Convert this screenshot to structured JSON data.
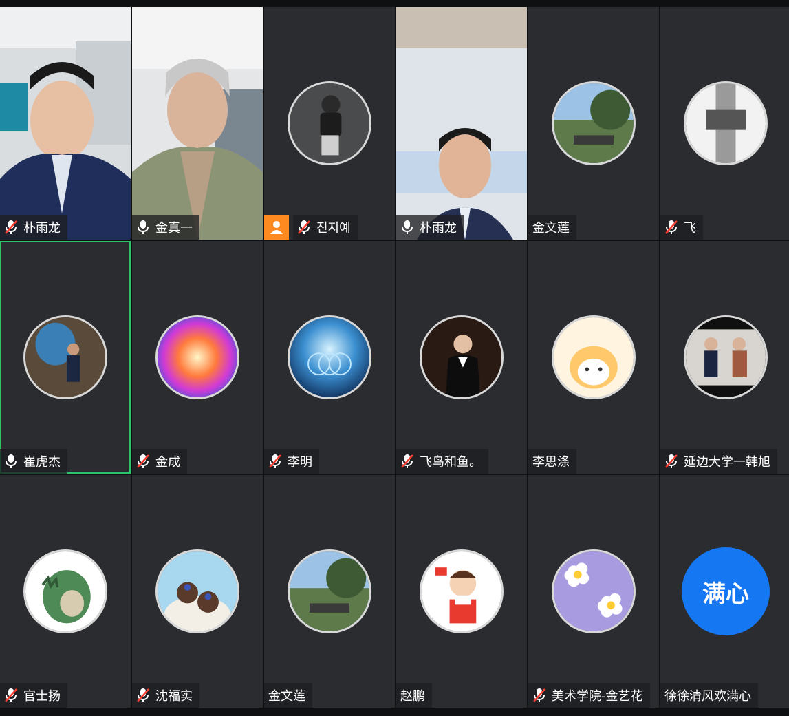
{
  "meeting": {
    "participants": [
      {
        "name": "朴雨龙",
        "mic": "muted",
        "type": "video",
        "active": false
      },
      {
        "name": "金真一",
        "mic": "on",
        "type": "video",
        "active": false
      },
      {
        "name": "진지예",
        "mic": "muted",
        "type": "avatar",
        "host_badge": true,
        "active": false
      },
      {
        "name": "朴雨龙",
        "mic": "on",
        "type": "video",
        "active": true
      },
      {
        "name": "金文莲",
        "mic": "none",
        "type": "avatar",
        "active": false
      },
      {
        "name": "飞",
        "mic": "muted",
        "type": "avatar",
        "active": false
      },
      {
        "name": "崔虎杰",
        "mic": "on",
        "type": "avatar",
        "active": true
      },
      {
        "name": "金成",
        "mic": "muted",
        "type": "avatar",
        "active": false
      },
      {
        "name": "李明",
        "mic": "muted",
        "type": "avatar",
        "active": false
      },
      {
        "name": "飞鸟和鱼。",
        "mic": "muted",
        "type": "avatar",
        "active": false
      },
      {
        "name": "李思涤",
        "mic": "none",
        "type": "avatar",
        "active": false
      },
      {
        "name": "延边大学一韩旭",
        "mic": "muted",
        "type": "avatar",
        "active": false
      },
      {
        "name": "官士扬",
        "mic": "muted",
        "type": "avatar",
        "active": false
      },
      {
        "name": "沈福实",
        "mic": "muted",
        "type": "avatar",
        "active": false
      },
      {
        "name": "金文莲",
        "mic": "none",
        "type": "avatar",
        "active": false
      },
      {
        "name": "赵鹏",
        "mic": "none",
        "type": "avatar",
        "active": false
      },
      {
        "name": "美术学院-金艺花",
        "mic": "muted",
        "type": "avatar",
        "active": false
      },
      {
        "name": "徐徐清风欢满心",
        "mic": "none",
        "type": "text-avatar",
        "avatar_text": "满心",
        "active": false
      }
    ]
  },
  "colors": {
    "tile_bg": "#2b2c2f",
    "active_border": "#2ec46b",
    "muted_red": "#ff3b30",
    "host_badge": "#ff8a1f",
    "text_avatar_bg": "#1677f2"
  }
}
